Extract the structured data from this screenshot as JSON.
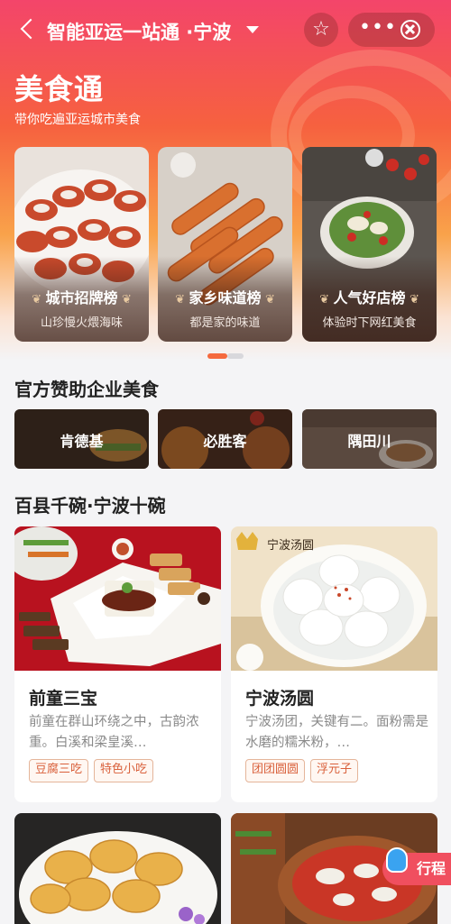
{
  "topbar": {
    "title": "智能亚运一站通 ·宁波",
    "back_icon": "chevron-left-icon",
    "star_icon": "star-icon",
    "more_label": "•••",
    "close_icon": "close-circle-icon"
  },
  "hero": {
    "title": "美食通",
    "subtitle": "带你吃遍亚运城市美食"
  },
  "featured": [
    {
      "name": "城市招牌榜",
      "desc": "山珍慢火煨海味"
    },
    {
      "name": "家乡味道榜",
      "desc": "都是家的味道"
    },
    {
      "name": "人气好店榜",
      "desc": "体验时下网红美食"
    }
  ],
  "carousel": {
    "active_index": 0,
    "count": 2
  },
  "sponsor": {
    "title": "官方赞助企业美食",
    "brands": [
      "肯德基",
      "必胜客",
      "隅田川"
    ]
  },
  "bowls": {
    "title": "百县千碗·宁波十碗",
    "dishes": [
      {
        "name": "前童三宝",
        "desc": "前童在群山环绕之中，古韵浓重。白溪和梁皇溪…",
        "tags": [
          "豆腐三吃",
          "特色小吃"
        ]
      },
      {
        "name": "宁波汤圆",
        "desc": "宁波汤团，关键有二。面粉需是水磨的糯米粉，…",
        "tags": [
          "团团圆圆",
          "浮元子"
        ],
        "watermark": "宁波汤圆"
      }
    ]
  },
  "floating": {
    "trip_label": "行程"
  },
  "colors": {
    "accent": "#f56a3e",
    "tag_text": "#d9603b",
    "hero_top": "#f3456a"
  }
}
